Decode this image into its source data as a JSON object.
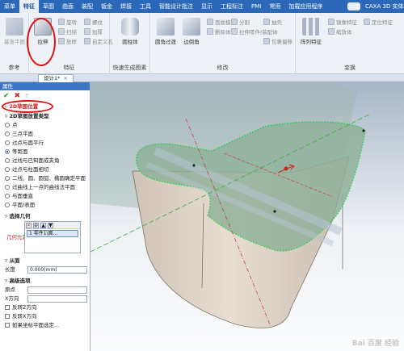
{
  "menubar": {
    "items": [
      "菜单",
      "特征",
      "草图",
      "曲面",
      "装配",
      "钣金",
      "焊接",
      "工具",
      "智能设计批注",
      "显示",
      "工程标注",
      "PMI",
      "常用",
      "加载应用程序"
    ],
    "active_index": 1,
    "app_title": "CAXA 3D 实体"
  },
  "ribbon": {
    "groups": [
      {
        "label": "参考",
        "buttons": [
          "基准平面"
        ]
      },
      {
        "label": "特征",
        "buttons": [
          "拉伸",
          "旋转",
          "扫描",
          "螺纹",
          "加厚",
          "放样",
          "自定义孔"
        ]
      },
      {
        "label": "快速生成图素",
        "buttons": [
          "圆柱体"
        ]
      },
      {
        "label": "修改",
        "buttons": [
          "圆角过渡",
          "边倒角",
          "面拔模",
          "分割",
          "拉伸零件/装配体",
          "删除体",
          "抽壳",
          "包裹偏移"
        ]
      },
      {
        "label": "变换",
        "buttons": [
          "阵列特征",
          "镜像特征",
          "缩放体",
          "定位特征"
        ]
      }
    ],
    "extrude_label": "拉伸"
  },
  "tabbar": {
    "doc_tab": "设计1*",
    "close": "×"
  },
  "panel": {
    "title": "属性",
    "actions": {
      "ok": "✔",
      "cancel": "✖",
      "help": "?"
    },
    "sketch_position": "2D草图位置",
    "section_type": "2D草图放置类型",
    "options": [
      "点",
      "三点平面",
      "过点与面平行",
      "等距面",
      "过线与已知面成夹角",
      "过点与柱面相切",
      "二线、圆、圆弧、椭圆确定平面",
      "过曲线上一点的曲线法平面",
      "与面垂直",
      "平面/表面"
    ],
    "selected_option": 3,
    "select_geometry": "选择几何",
    "geo_label": "几何元素",
    "geo_tools": [
      "✕",
      "⊕",
      "▲",
      "▼"
    ],
    "geo_item": "1 零件1\\面...",
    "from_face": "从面",
    "length_label": "长度",
    "length_value": "0.000(mm)",
    "advanced": "高级选项",
    "origin_label": "原点",
    "xdir_label": "X方向",
    "checks": [
      "反转Z方向",
      "反转X方向",
      "如果坐标平面选定..."
    ]
  },
  "watermark": "Bai 百度 经验",
  "colors": {
    "menubar": "#2b68b8",
    "annotation": "#e01010",
    "selection": "#22cc44"
  }
}
